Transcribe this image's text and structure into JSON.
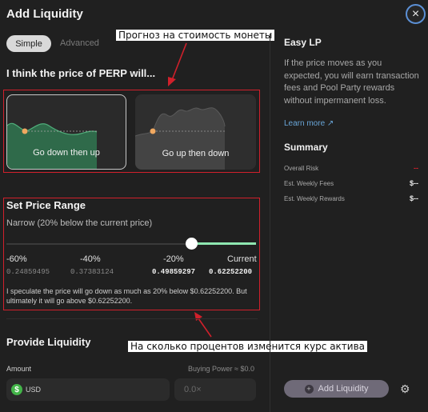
{
  "header": {
    "title": "Add Liquidity",
    "close_icon": "×"
  },
  "tabs": [
    {
      "label": "Simple",
      "active": true
    },
    {
      "label": "Advanced",
      "active": false
    }
  ],
  "annotations": {
    "top": "Прогноз на стоимость монеты",
    "bottom": "На сколько процентов изменится курс актива"
  },
  "predict": {
    "heading": "I think the price of PERP will...",
    "options": [
      {
        "label": "Go down then up",
        "selected": true
      },
      {
        "label": "Go up then down",
        "selected": false
      }
    ]
  },
  "price_range": {
    "heading": "Set Price Range",
    "description": "Narrow (20% below the current price)",
    "slider_level": 0.26,
    "ticks": [
      {
        "label": "-60%",
        "value": "0.24859495"
      },
      {
        "label": "-40%",
        "value": "0.37383124"
      },
      {
        "label": "-20%",
        "value": "0.49859297"
      },
      {
        "label": "Current",
        "value": "0.62252200"
      }
    ],
    "speculation": "I speculate the price will go down as much as 20% below $0.62252200. But ultimately it will go above $0.62252200."
  },
  "provide": {
    "heading": "Provide Liquidity",
    "amount_label": "Amount",
    "buying_power": "Buying Power ≈ $0.0",
    "usd_icon": "$",
    "currency": "USD",
    "leverage_placeholder": "0.0×"
  },
  "easy_lp": {
    "heading": "Easy LP",
    "description": "If the price moves as you expected, you will earn transaction fees and Pool Party rewards without impermanent loss.",
    "learn_more": "Learn more ↗"
  },
  "summary": {
    "heading": "Summary",
    "rows": [
      {
        "label": "Overall Risk",
        "value": "--"
      },
      {
        "label": "Est. Weekly Fees",
        "value": "$--"
      },
      {
        "label": "Est. Weekly Rewards",
        "value": "$--"
      }
    ]
  },
  "footer": {
    "add_button": "Add Liquidity",
    "plus_icon": "+",
    "gear_icon": "⚙"
  },
  "colors": {
    "accent_green": "#3f9c6a",
    "slider_green": "#8ee6b0",
    "marker_orange": "#f0a860",
    "annotation_red": "#d0202b",
    "link_blue": "#69a6d8"
  }
}
